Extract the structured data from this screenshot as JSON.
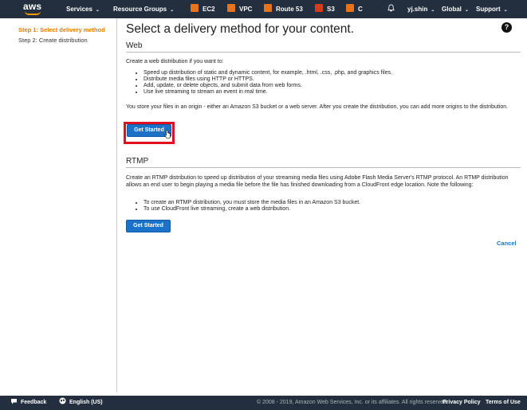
{
  "nav": {
    "logo": "aws",
    "services": "Services",
    "resource_groups": "Resource Groups",
    "ec2": "EC2",
    "vpc": "VPC",
    "route53": "Route 53",
    "s3": "S3",
    "c": "C",
    "user": "yj.shin",
    "region": "Global",
    "support": "Support",
    "caret": "⌄",
    "bell_icon": "bell-icon",
    "brand_color": "#ff9900"
  },
  "sidebar": {
    "steps": [
      {
        "label": "Step 1: Select delivery method"
      },
      {
        "label": "Step 2: Create distribution"
      }
    ]
  },
  "main": {
    "title": "Select a delivery method for your content.",
    "help": "?",
    "web": {
      "heading": "Web",
      "intro": "Create a web distribution if you want to:",
      "bullets": [
        "Speed up distribution of static and dynamic content, for example, .html, .css, .php, and graphics files.",
        "Distribute media files using HTTP or HTTPS.",
        "Add, update, or delete objects, and submit data from web forms.",
        "Use live streaming to stream an event in real time."
      ],
      "note": "You store your files in an origin - either an Amazon S3 bucket or a web server. After you create the distribution, you can add more origins to the distribution.",
      "button": "Get Started"
    },
    "rtmp": {
      "heading": "RTMP",
      "intro": "Create an RTMP distribution to speed up distribution of your streaming media files using Adobe Flash Media Server's RTMP protocol. An RTMP distribution allows an end user to begin playing a media file before the file has finished downloading from a CloudFront edge location. Note the following:",
      "bullets": [
        "To create an RTMP distribution, you must store the media files in an Amazon S3 bucket.",
        "To use CloudFront live streaming, create a web distribution."
      ],
      "button": "Get Started"
    },
    "cancel": "Cancel"
  },
  "footer": {
    "feedback": "Feedback",
    "language": "English (US)",
    "copyright": "© 2008 - 2019, Amazon Web Services, Inc. or its affiliates. All rights reserved.",
    "privacy": "Privacy Policy",
    "terms": "Terms of Use"
  }
}
